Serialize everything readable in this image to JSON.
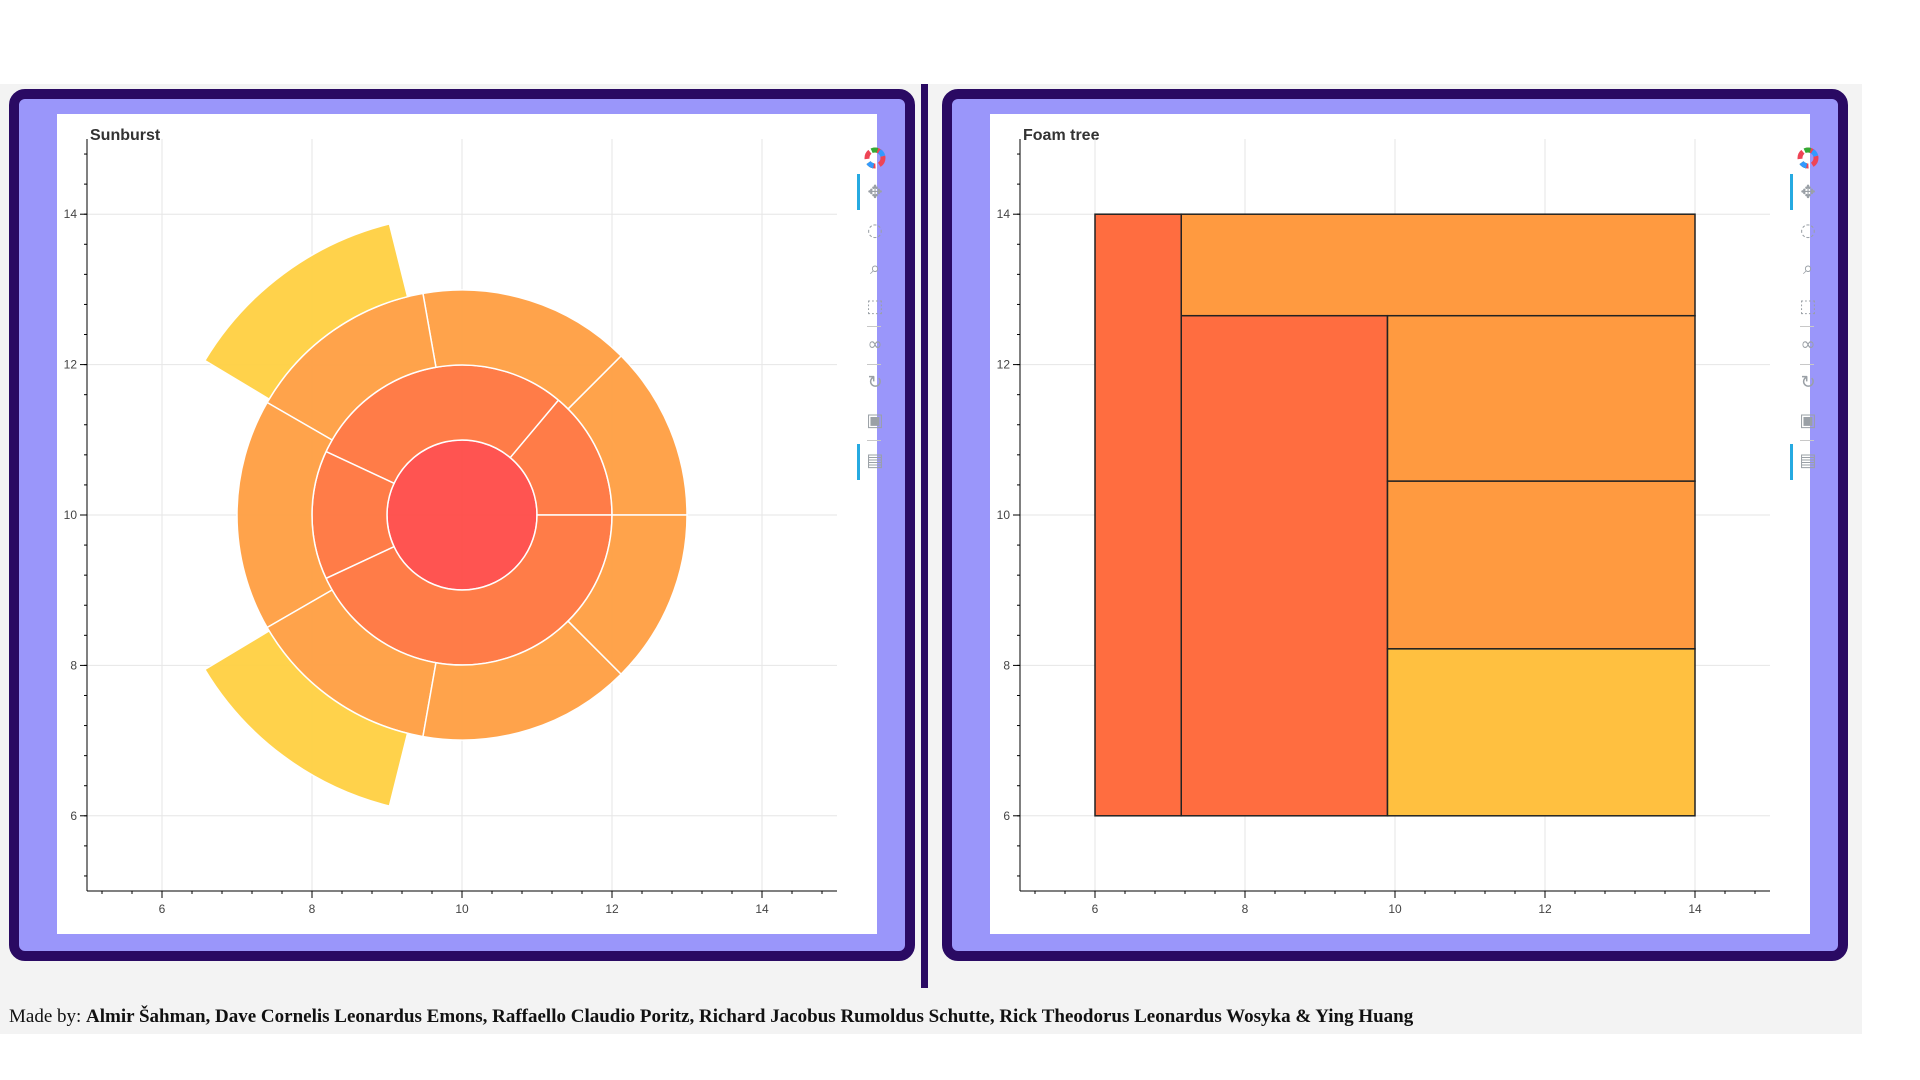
{
  "footer": {
    "prefix": "Made by: ",
    "authors": "Almir Šahman, Dave Cornelis Leonardus Emons, Raffaello Claudio Poritz, Richard Jacobus Rumoldus Schutte, Rick Theodorus Leonardus Wosyka & Ying Huang"
  },
  "toolbar_icons": [
    "bokeh-logo-icon",
    "pan-icon",
    "lasso-select-icon",
    "wheel-zoom-icon",
    "box-select-icon",
    "tap-icon",
    "reset-icon",
    "save-icon",
    "hover-icon"
  ],
  "colors": {
    "frame": "#2a0a63",
    "panel": "#9a96fa",
    "level0": "#ff4f4c",
    "level1": "#ff7843",
    "level2": "#ffa146",
    "level3": "#ffd146",
    "foam_red": "#ff6d40",
    "foam_orange": "#ff9a40",
    "foam_yellow": "#ffc040"
  },
  "chart_data": [
    {
      "type": "sunburst",
      "title": "Sunburst",
      "xlim": [
        5,
        15
      ],
      "ylim": [
        5,
        15
      ],
      "x_ticks": [
        6,
        8,
        10,
        12,
        14
      ],
      "y_ticks": [
        6,
        8,
        10,
        12,
        14
      ],
      "center": [
        10,
        10
      ],
      "rings": [
        {
          "level": 0,
          "inner_radius": 0,
          "outer_radius": 1,
          "segments": [
            {
              "start_deg": 0,
              "end_deg": 360
            }
          ]
        },
        {
          "level": 1,
          "inner_radius": 1,
          "outer_radius": 2,
          "segments": [
            {
              "start_deg": 0,
              "end_deg": 50
            },
            {
              "start_deg": 50,
              "end_deg": 155
            },
            {
              "start_deg": 155,
              "end_deg": 205
            },
            {
              "start_deg": 205,
              "end_deg": 360
            }
          ]
        },
        {
          "level": 2,
          "inner_radius": 2,
          "outer_radius": 3,
          "segments": [
            {
              "start_deg": 0,
              "end_deg": 45
            },
            {
              "start_deg": 45,
              "end_deg": 100
            },
            {
              "start_deg": 100,
              "end_deg": 150
            },
            {
              "start_deg": 150,
              "end_deg": 210
            },
            {
              "start_deg": 210,
              "end_deg": 260
            },
            {
              "start_deg": 260,
              "end_deg": 315
            },
            {
              "start_deg": 315,
              "end_deg": 360
            }
          ]
        },
        {
          "level": 3,
          "inner_radius": 3,
          "outer_radius": 4,
          "segments": [
            {
              "start_deg": 104,
              "end_deg": 149
            },
            {
              "start_deg": 211,
              "end_deg": 256
            }
          ]
        }
      ]
    },
    {
      "type": "foam_tree",
      "title": "Foam tree",
      "xlim": [
        5,
        15
      ],
      "ylim": [
        5,
        15
      ],
      "x_ticks": [
        6,
        8,
        10,
        12,
        14
      ],
      "y_ticks": [
        6,
        8,
        10,
        12,
        14
      ],
      "rects": [
        {
          "x0": 6,
          "y0": 6,
          "x1": 7.15,
          "y1": 14,
          "color": "red"
        },
        {
          "x0": 7.15,
          "y0": 12.65,
          "x1": 14,
          "y1": 14,
          "color": "orange"
        },
        {
          "x0": 7.15,
          "y0": 6,
          "x1": 9.9,
          "y1": 12.65,
          "color": "red"
        },
        {
          "x0": 9.9,
          "y0": 10.45,
          "x1": 14,
          "y1": 12.65,
          "color": "orange"
        },
        {
          "x0": 9.9,
          "y0": 8.22,
          "x1": 14,
          "y1": 10.45,
          "color": "orange"
        },
        {
          "x0": 9.9,
          "y0": 6,
          "x1": 14,
          "y1": 8.22,
          "color": "yellow"
        }
      ]
    }
  ]
}
